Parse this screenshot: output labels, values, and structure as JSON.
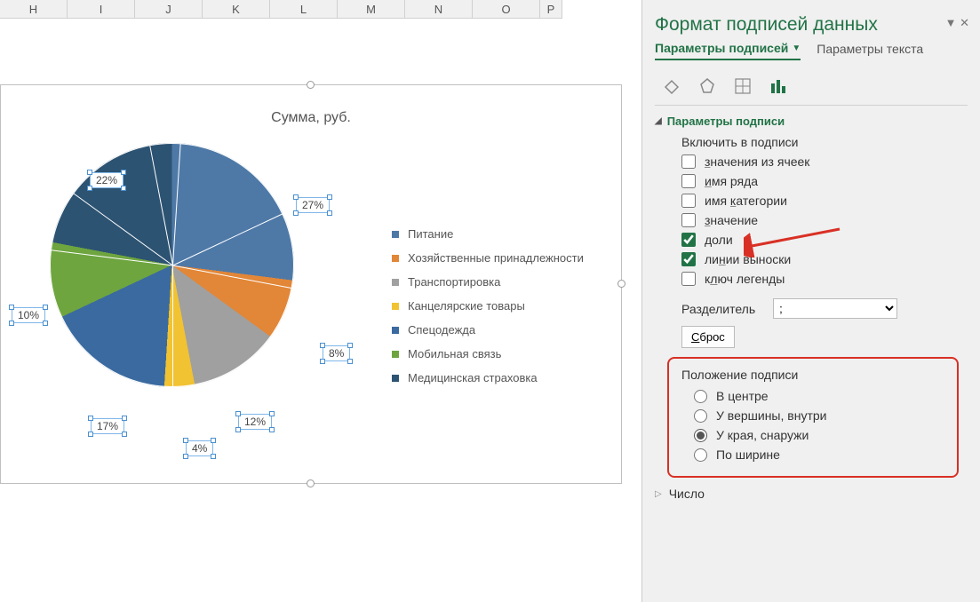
{
  "columns": [
    "H",
    "I",
    "J",
    "K",
    "L",
    "M",
    "N",
    "O",
    "P"
  ],
  "chart_title": "Сумма, руб.",
  "chart_data": {
    "type": "pie",
    "title": "Сумма, руб.",
    "categories": [
      "Питание",
      "Хозяйственные принадлежности",
      "Транспортировка",
      "Канцелярские товары",
      "Спецодежда",
      "Мобильная связь",
      "Медицинская страховка"
    ],
    "values_pct": [
      27,
      8,
      12,
      4,
      17,
      10,
      22
    ],
    "colors": [
      "#4e79a7",
      "#e28637",
      "#a0a0a0",
      "#f1c232",
      "#3a6aa0",
      "#6ea53f",
      "#2d5372"
    ]
  },
  "labels": {
    "l27": "27%",
    "l8": "8%",
    "l12": "12%",
    "l4": "4%",
    "l17": "17%",
    "l10": "10%",
    "l22": "22%"
  },
  "legend": [
    {
      "label": "Питание",
      "color": "#4e79a7"
    },
    {
      "label": "Хозяйственные принадлежности",
      "color": "#e28637"
    },
    {
      "label": "Транспортировка",
      "color": "#a0a0a0"
    },
    {
      "label": "Канцелярские товары",
      "color": "#f1c232"
    },
    {
      "label": "Спецодежда",
      "color": "#3a6aa0"
    },
    {
      "label": "Мобильная связь",
      "color": "#6ea53f"
    },
    {
      "label": "Медицинская страховка",
      "color": "#2d5372"
    }
  ],
  "panel": {
    "title": "Формат подписей данных",
    "tab1": "Параметры подписей",
    "tab2": "Параметры текста",
    "section1": "Параметры подписи",
    "include_label": "Включить в подписи",
    "cb_cells": "значения из ячеек",
    "cb_series": "имя ряда",
    "cb_cat": "имя категории",
    "cb_val": "значение",
    "cb_pct": "доли",
    "cb_leader": "линии выноски",
    "cb_legend": "ключ легенды",
    "sep_label": "Разделитель",
    "sep_value": ";",
    "reset": "Сброс",
    "pos_title": "Положение подписи",
    "r_center": "В центре",
    "r_intop": "У вершины, внутри",
    "r_outend": "У края, снаружи",
    "r_bestfit": "По ширине",
    "num_section": "Число"
  }
}
